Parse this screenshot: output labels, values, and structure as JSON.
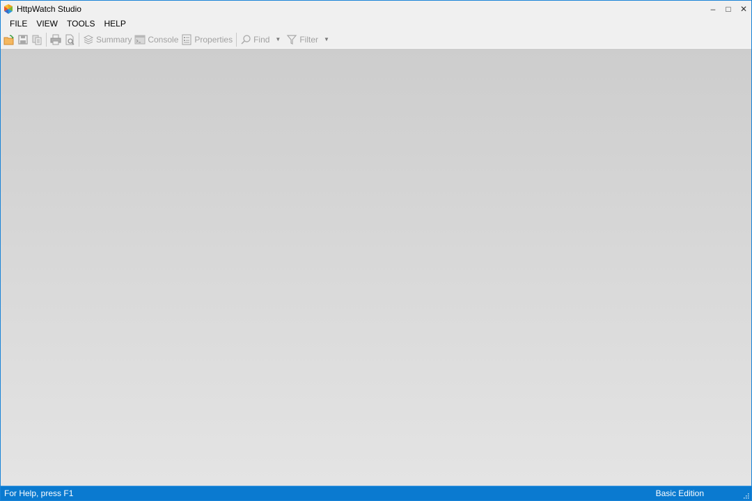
{
  "window": {
    "title": "HttpWatch Studio",
    "controls": {
      "minimize": "–",
      "maximize": "□",
      "close": "✕"
    }
  },
  "menu": {
    "items": [
      "FILE",
      "VIEW",
      "TOOLS",
      "HELP"
    ]
  },
  "toolbar": {
    "open": "open-folder-icon",
    "save": "save-icon",
    "copy": "copy-icon",
    "print": "print-icon",
    "print_preview": "print-preview-icon",
    "summary_label": "Summary",
    "console_label": "Console",
    "properties_label": "Properties",
    "find_label": "Find",
    "filter_label": "Filter"
  },
  "statusbar": {
    "left": "For Help, press F1",
    "right": "Basic Edition"
  },
  "colors": {
    "accent": "#0a7ad0",
    "window_border": "#1883d7",
    "disabled_text": "#a0a0a0"
  }
}
